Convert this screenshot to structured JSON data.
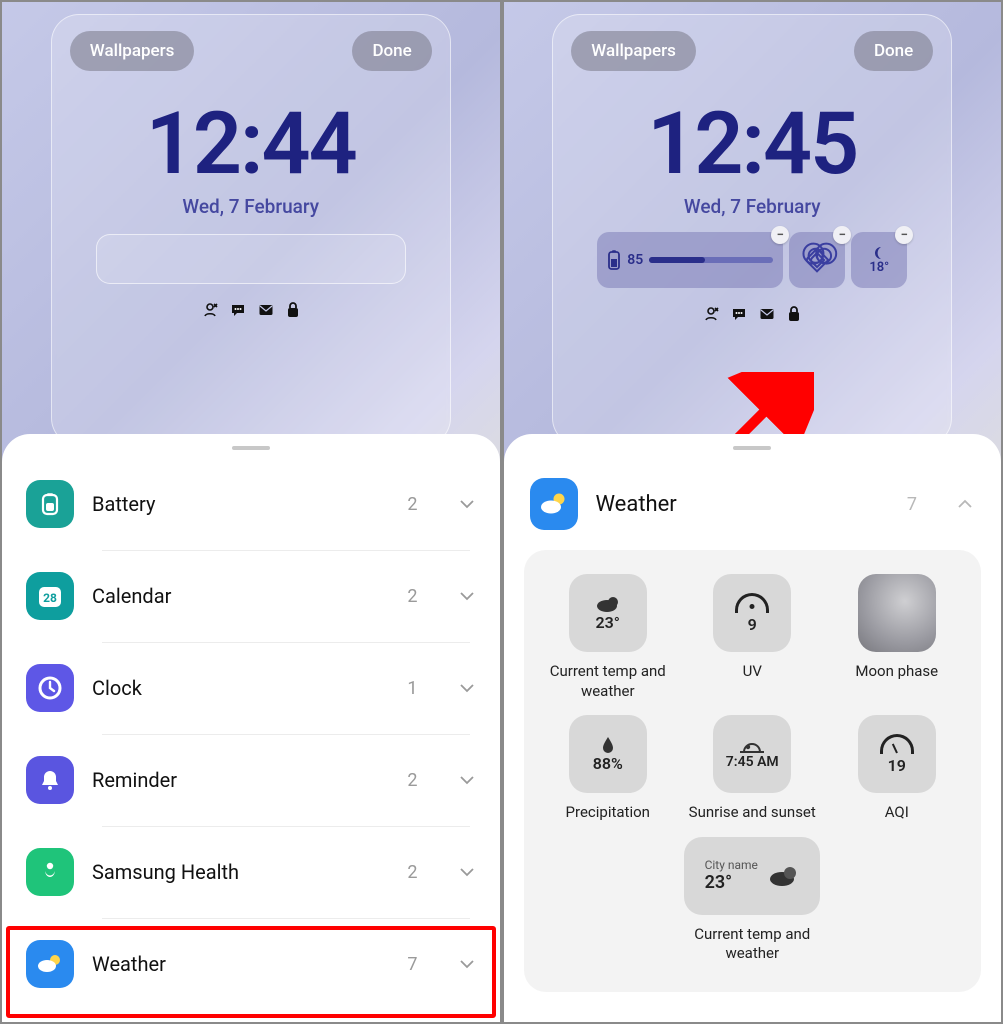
{
  "left": {
    "wallpapers_btn": "Wallpapers",
    "done_btn": "Done",
    "clock": "12:44",
    "date": "Wed, 7 February",
    "apps": [
      {
        "name": "Battery",
        "count": "2",
        "icon_bg": "bg-teal"
      },
      {
        "name": "Calendar",
        "count": "2",
        "icon_bg": "bg-teal2"
      },
      {
        "name": "Clock",
        "count": "1",
        "icon_bg": "bg-violet"
      },
      {
        "name": "Reminder",
        "count": "2",
        "icon_bg": "bg-indigo"
      },
      {
        "name": "Samsung Health",
        "count": "2",
        "icon_bg": "bg-green"
      },
      {
        "name": "Weather",
        "count": "7",
        "icon_bg": "bg-blue"
      }
    ],
    "calendar_day": "28"
  },
  "right": {
    "wallpapers_btn": "Wallpapers",
    "done_btn": "Done",
    "clock": "12:45",
    "date": "Wed, 7 February",
    "mini_widgets": {
      "battery_value": "85",
      "temp_value": "18°"
    },
    "header": {
      "title": "Weather",
      "count": "7"
    },
    "widgets": [
      {
        "value": "23°",
        "label": "Current temp and weather"
      },
      {
        "value": "9",
        "label": "UV"
      },
      {
        "value": "",
        "label": "Moon phase"
      },
      {
        "value": "88%",
        "label": "Precipitation"
      },
      {
        "value": "7:45 AM",
        "label": "Sunrise and sunset"
      },
      {
        "value": "19",
        "label": "AQI"
      }
    ],
    "big_widget": {
      "city_label": "City name",
      "value": "23°",
      "label": "Current temp and weather"
    }
  }
}
